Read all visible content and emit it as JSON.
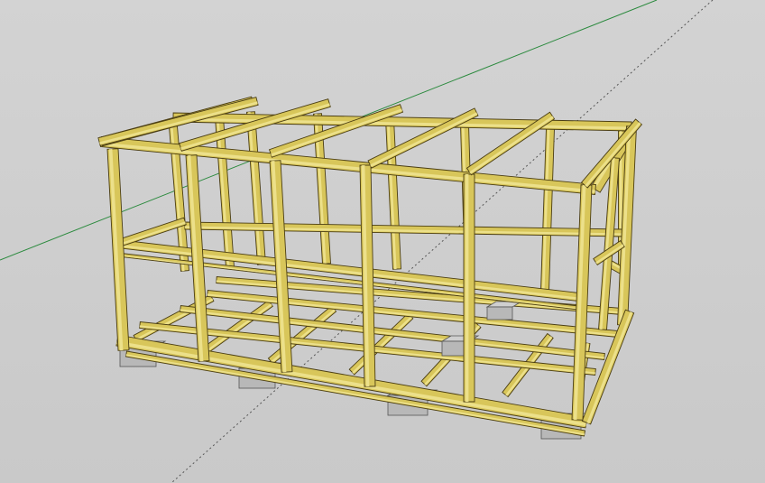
{
  "app": {
    "view": "sketchup-3d-viewport",
    "model": "wooden-shed-frame",
    "background_color": "#cfcfcf"
  },
  "colors": {
    "timber": "#d8c65a",
    "timber_light": "#ece08a",
    "timber_dark": "#a99338",
    "timber_edge": "#4a3d12",
    "concrete": "#b8b8b8",
    "concrete_dark": "#8e8e8e",
    "axis_green": "#2b8a3e",
    "axis_inference": "#555555"
  },
  "axes": {
    "green_axis": "y-axis",
    "dotted_axis": "inference-axis"
  },
  "frame": {
    "front_posts": 6,
    "roof_joists": 6,
    "foundation_blocks": 6
  }
}
